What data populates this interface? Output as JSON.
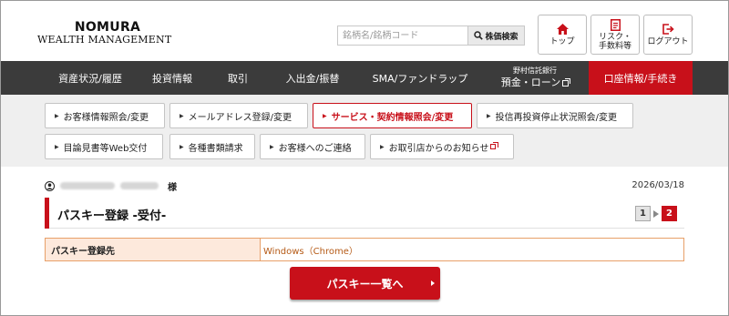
{
  "brand": {
    "logo_main": "NOMURA",
    "logo_sub": "WEALTH MANAGEMENT",
    "accent_color": "#c8101a",
    "nav_bg_color": "#3b3b3b"
  },
  "search": {
    "placeholder": "銘柄名/銘柄コード",
    "button_label": "株価検索",
    "icon": "search-icon"
  },
  "top_buttons": [
    {
      "label": "トップ",
      "icon": "home-icon"
    },
    {
      "label": "リスク・\n手数料等",
      "icon": "document-icon"
    },
    {
      "label": "ログアウト",
      "icon": "logout-icon"
    }
  ],
  "main_nav": [
    {
      "label": "資産状況/履歴"
    },
    {
      "label": "投資情報"
    },
    {
      "label": "取引"
    },
    {
      "label": "入出金/振替"
    },
    {
      "label": "SMA/ファンドラップ"
    },
    {
      "small_label": "野村信託銀行",
      "label": "預金・ローン",
      "external": true
    },
    {
      "label": "口座情報/手続き",
      "active": true
    }
  ],
  "sub_nav": [
    {
      "label": "お客様情報照会/変更"
    },
    {
      "label": "メールアドレス登録/変更"
    },
    {
      "label": "サービス・契約情報照会/変更",
      "active": true
    },
    {
      "label": "投信再投資停止状況照会/変更"
    },
    {
      "label": "目論見書等Web交付"
    },
    {
      "label": "各種書類請求"
    },
    {
      "label": "お客様へのご連絡"
    },
    {
      "label": "お取引店からのお知らせ",
      "external": true
    }
  ],
  "user": {
    "honorific": "様",
    "icon": "user-icon"
  },
  "date": "2026/03/18",
  "page_title": "パスキー登録 -受付-",
  "steps": {
    "step1": "1",
    "step2": "2",
    "current": 2
  },
  "table": {
    "label": "パスキー登録先",
    "value": "Windows（Chrome）"
  },
  "cta_label": "パスキー一覧へ"
}
